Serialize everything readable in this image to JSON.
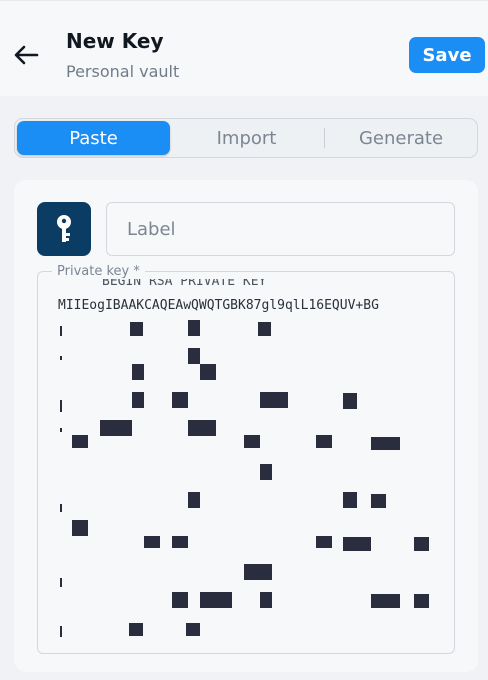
{
  "header": {
    "title": "New Key",
    "subtitle": "Personal vault",
    "save_label": "Save"
  },
  "tabs": [
    {
      "label": "Paste",
      "active": true
    },
    {
      "label": "Import",
      "active": false
    },
    {
      "label": "Generate",
      "active": false
    }
  ],
  "form": {
    "label_placeholder": "Label",
    "label_value": "",
    "private_key_label": "Private key *",
    "private_key_line1": "BEGIN RSA PRIVATE KEY",
    "private_key_line2": "MIIEogIBAAKCAQEAwQWQTGBK87gl9qlL16EQUV+BG"
  },
  "colors": {
    "accent": "#1a8ef5",
    "icon_bg": "#0b3c64",
    "redaction": "#2a2d3e"
  },
  "icons": {
    "back": "arrow-left-icon",
    "key": "key-icon"
  }
}
